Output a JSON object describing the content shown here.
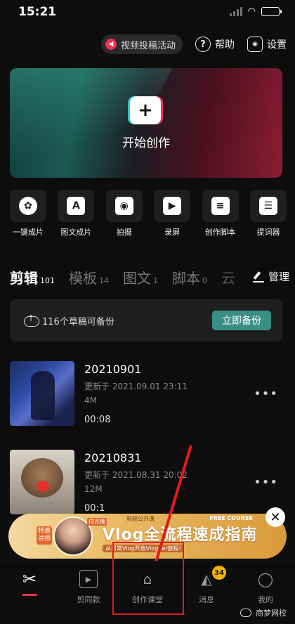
{
  "status": {
    "time": "15:21"
  },
  "top": {
    "promo_label": "视频投稿活动",
    "help_label": "帮助",
    "settings_label": "设置"
  },
  "hero": {
    "label": "开始创作"
  },
  "tools": [
    {
      "label": "一键成片",
      "icon": "film-reel-icon"
    },
    {
      "label": "图文成片",
      "icon": "text-to-video-icon"
    },
    {
      "label": "拍摄",
      "icon": "camera-icon"
    },
    {
      "label": "录屏",
      "icon": "screen-record-icon"
    },
    {
      "label": "创作脚本",
      "icon": "script-icon"
    },
    {
      "label": "提词器",
      "icon": "teleprompter-icon"
    }
  ],
  "tabs": [
    {
      "label": "剪辑",
      "count": "101"
    },
    {
      "label": "模板",
      "count": "14"
    },
    {
      "label": "图文",
      "count": "1"
    },
    {
      "label": "脚本",
      "count": "0"
    },
    {
      "label": "云",
      "count": ""
    }
  ],
  "manage_label": "管理",
  "backup": {
    "message": "116个草稿可备份",
    "button": "立即备份"
  },
  "drafts": [
    {
      "title": "20210901",
      "updated": "更新于 2021.09.01 23:11",
      "size": "4M",
      "duration": "00:08"
    },
    {
      "title": "20210831",
      "updated": "更新于 2021.08.31 20:02",
      "size": "12M",
      "duration": "00:1"
    }
  ],
  "banner": {
    "tag_top": "剪映公开课",
    "tag_right": "FREE COURSE",
    "headline": "Vlog全流程速成指南",
    "sub": "从日常Vlog开启Vlogger旅程!",
    "side_tag": "特邀讲师",
    "name_tag": "何光楠"
  },
  "nav": [
    {
      "label": ""
    },
    {
      "label": "剪同款"
    },
    {
      "label": "创作课堂"
    },
    {
      "label": "消息",
      "badge": "34"
    },
    {
      "label": "我的"
    }
  ],
  "watermark": "商梦网校",
  "colors": {
    "accent_red": "#e8344e",
    "backup_button": "#3a8f84",
    "banner_gold": "#e9b962",
    "annotation_red": "#e21a1a"
  }
}
